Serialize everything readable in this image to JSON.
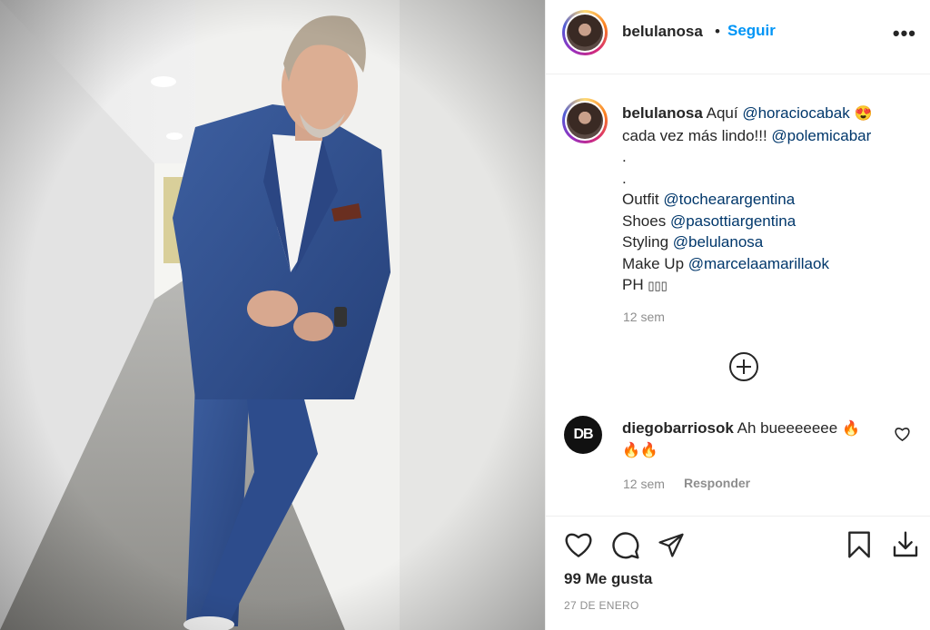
{
  "post": {
    "author": "belulanosa",
    "separator": "•",
    "follow_label": "Seguir",
    "more_label": "•••"
  },
  "caption": {
    "username": "belulanosa",
    "line1_prefix": "Aquí ",
    "line1_mention": "@horaciocabak",
    "line1_emoji": "😍",
    "line2_prefix": "cada vez más lindo!!! ",
    "line2_mention": "@polemicabar",
    "dot1": ".",
    "dot2": ".",
    "outfit_label": "Outfit ",
    "outfit_mention": "@tochearargentina",
    "shoes_label": "Shoes ",
    "shoes_mention": "@pasottiargentina",
    "styling_label": "Styling ",
    "styling_mention": "@belulanosa",
    "makeup_label": "Make Up ",
    "makeup_mention": "@marcelaamarillaok",
    "ph_label": "PH ",
    "ph_glyphs": "▯▯▯",
    "time": "12 sem"
  },
  "comment": {
    "avatar_text": "DB",
    "username": "diegobarriosok",
    "text": "Ah bueeeeeee",
    "emoji_line1": "🔥",
    "emoji_line2": "🔥🔥",
    "time": "12 sem",
    "reply_label": "Responder"
  },
  "footer": {
    "likes": "99 Me gusta",
    "date": "27 DE ENERO"
  },
  "icons": {
    "like": "heart-icon",
    "comment": "comment-icon",
    "share": "share-icon",
    "save": "bookmark-icon",
    "download": "download-icon",
    "add_comment": "plus-circle-icon"
  },
  "colors": {
    "link": "#00376b",
    "follow": "#0095f6",
    "muted": "#8e8e8e"
  }
}
